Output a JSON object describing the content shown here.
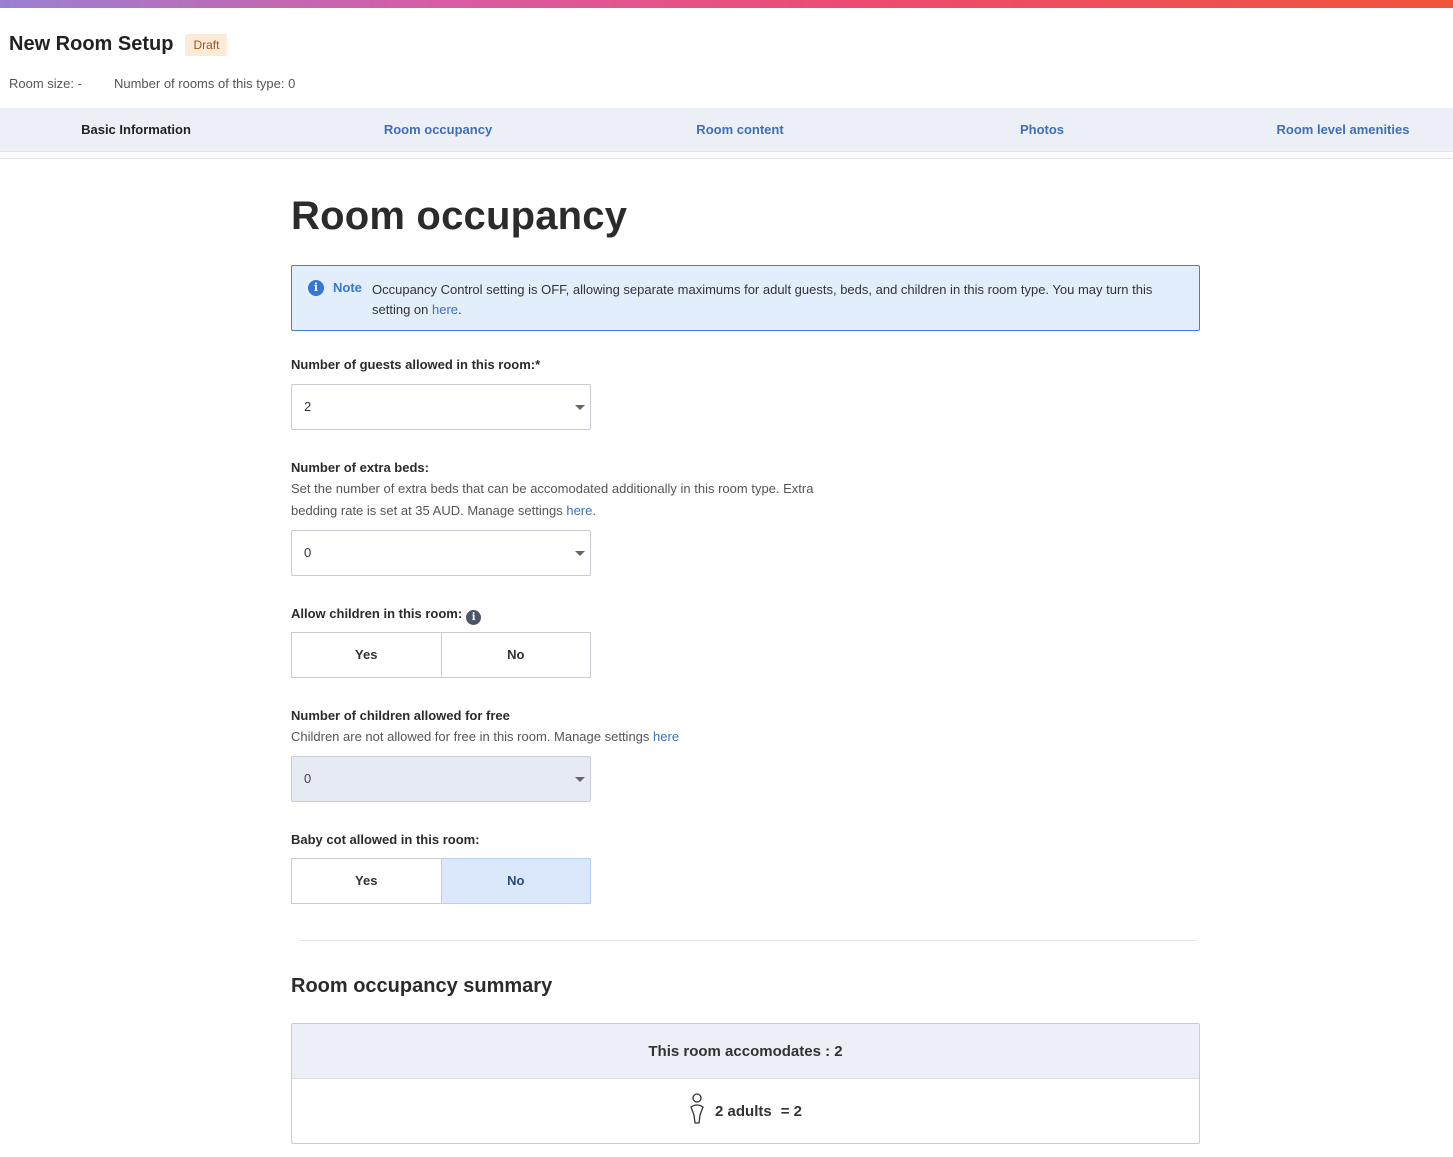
{
  "header": {
    "title": "New Room Setup",
    "status": "Draft",
    "room_size": "Room size: -",
    "rooms_count": "Number of rooms of this type: 0"
  },
  "tabs": [
    {
      "label": "Basic Information",
      "active": true
    },
    {
      "label": "Room occupancy",
      "active": false
    },
    {
      "label": "Room content",
      "active": false
    },
    {
      "label": "Photos",
      "active": false
    },
    {
      "label": "Room level amenities",
      "active": false
    }
  ],
  "section": {
    "title": "Room occupancy"
  },
  "note": {
    "icon": "info-icon",
    "title": "Note",
    "text": "Occupancy Control setting is OFF, allowing separate maximums for adult guests, beds, and children in this room type. You may turn this setting on ",
    "link": "here",
    "suffix": "."
  },
  "guests": {
    "label": "Number of guests allowed in this room:*",
    "value": "2"
  },
  "extra_beds": {
    "label": "Number of extra beds:",
    "helper": "Set the number of extra beds that can be accomodated additionally in this room type. Extra bedding rate is set at 35 AUD. Manage settings ",
    "link": "here",
    "suffix": ".",
    "value": "0"
  },
  "children": {
    "label": "Allow children in this room:",
    "yes": "Yes",
    "no": "No",
    "selected": null
  },
  "free_children": {
    "label": "Number of children allowed for free",
    "helper": "Children are not allowed for free in this room. Manage settings ",
    "link": "here",
    "value": "0"
  },
  "baby_cot": {
    "label": "Baby cot allowed in this room:",
    "yes": "Yes",
    "no": "No",
    "selected": "No"
  },
  "summary": {
    "title": "Room occupancy summary",
    "accommodates": "This room accomodates : 2",
    "adults": "2 adults",
    "total": "= 2"
  },
  "colors": {
    "accent": "#3f6fb5",
    "note_bg": "#e3eefd",
    "badge_bg": "#fdebd8",
    "selected_bg": "#dbe8fb"
  }
}
